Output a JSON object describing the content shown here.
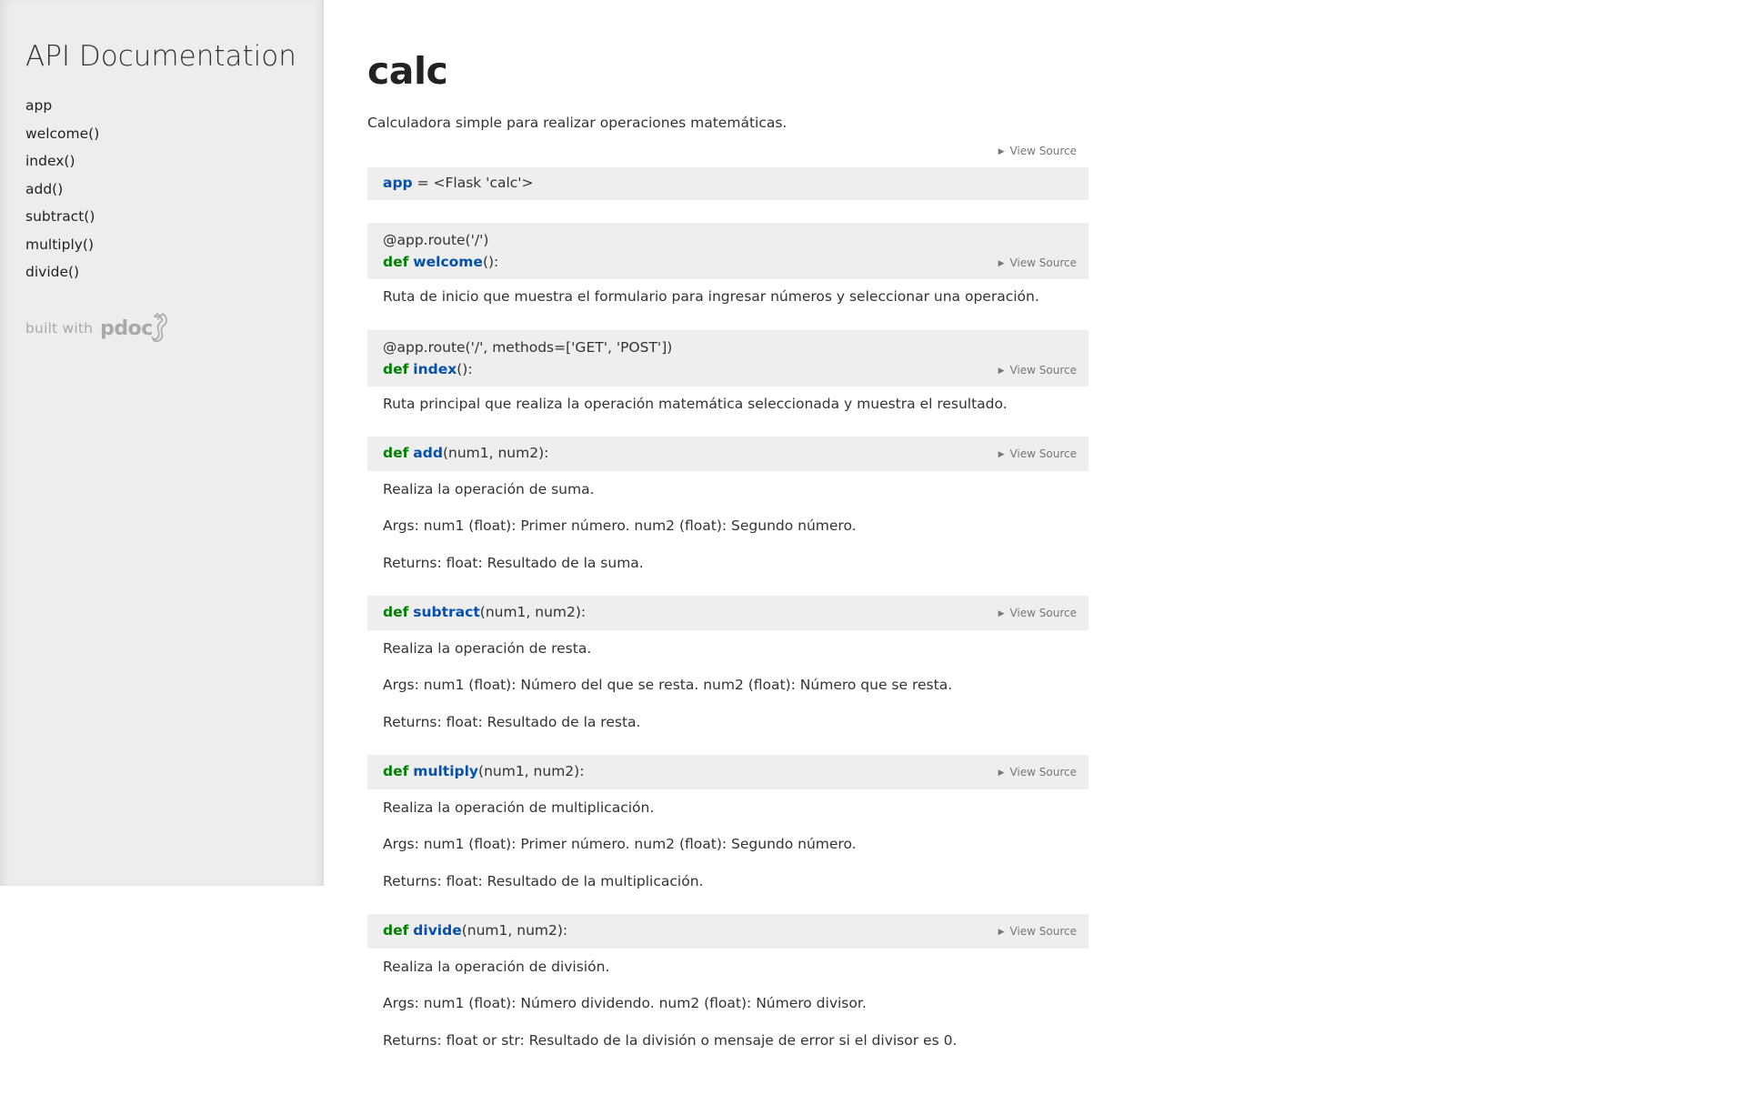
{
  "sidebar": {
    "title": "API Documentation",
    "nav": [
      "app",
      "welcome()",
      "index()",
      "add()",
      "subtract()",
      "multiply()",
      "divide()"
    ],
    "built_with": "built with",
    "logo_text": "pdoc"
  },
  "module": {
    "name": "calc",
    "docstring": "Calculadora simple para realizar operaciones matemáticas.",
    "view_source": "View Source"
  },
  "variable": {
    "name": "app",
    "value": " = <Flask 'calc'>"
  },
  "functions": {
    "welcome": {
      "decorator": "@app.route('/')",
      "kw": "def",
      "name": "welcome",
      "params": "():",
      "view_source": "View Source",
      "doc": [
        "Ruta de inicio que muestra el formulario para ingresar números y seleccionar una operación."
      ]
    },
    "index": {
      "decorator": "@app.route('/', methods=['GET', 'POST'])",
      "kw": "def",
      "name": "index",
      "params": "():",
      "view_source": "View Source",
      "doc": [
        "Ruta principal que realiza la operación matemática seleccionada y muestra el resultado."
      ]
    },
    "add": {
      "kw": "def",
      "name": "add",
      "params": "(num1, num2):",
      "view_source": "View Source",
      "doc": [
        "Realiza la operación de suma.",
        "Args: num1 (float): Primer número. num2 (float): Segundo número.",
        "Returns: float: Resultado de la suma."
      ]
    },
    "subtract": {
      "kw": "def",
      "name": "subtract",
      "params": "(num1, num2):",
      "view_source": "View Source",
      "doc": [
        "Realiza la operación de resta.",
        "Args: num1 (float): Número del que se resta. num2 (float): Número que se resta.",
        "Returns: float: Resultado de la resta."
      ]
    },
    "multiply": {
      "kw": "def",
      "name": "multiply",
      "params": "(num1, num2):",
      "view_source": "View Source",
      "doc": [
        "Realiza la operación de multiplicación.",
        "Args: num1 (float): Primer número. num2 (float): Segundo número.",
        "Returns: float: Resultado de la multiplicación."
      ]
    },
    "divide": {
      "kw": "def",
      "name": "divide",
      "params": "(num1, num2):",
      "view_source": "View Source",
      "doc": [
        "Realiza la operación de división.",
        "Args: num1 (float): Número dividendo. num2 (float): Número divisor.",
        "Returns: float or str: Resultado de la división o mensaje de error si el divisor es 0."
      ]
    }
  }
}
